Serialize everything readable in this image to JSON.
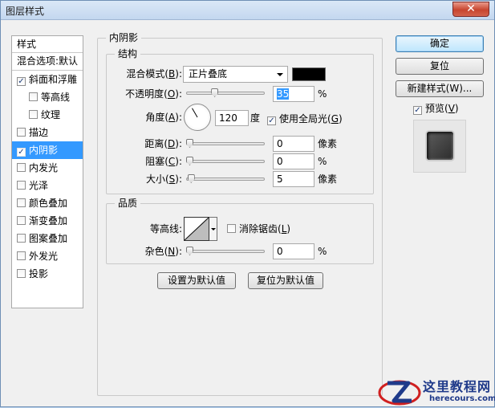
{
  "window": {
    "title": "图层样式"
  },
  "style_list": {
    "header": "样式",
    "blend_options": "混合选项:默认",
    "items": [
      {
        "label": "斜面和浮雕",
        "checked": true,
        "sub": false,
        "active": false
      },
      {
        "label": "等高线",
        "checked": false,
        "sub": true,
        "active": false
      },
      {
        "label": "纹理",
        "checked": false,
        "sub": true,
        "active": false
      },
      {
        "label": "描边",
        "checked": false,
        "sub": false,
        "active": false
      },
      {
        "label": "内阴影",
        "checked": true,
        "sub": false,
        "active": true
      },
      {
        "label": "内发光",
        "checked": false,
        "sub": false,
        "active": false
      },
      {
        "label": "光泽",
        "checked": false,
        "sub": false,
        "active": false
      },
      {
        "label": "颜色叠加",
        "checked": false,
        "sub": false,
        "active": false
      },
      {
        "label": "渐变叠加",
        "checked": false,
        "sub": false,
        "active": false
      },
      {
        "label": "图案叠加",
        "checked": false,
        "sub": false,
        "active": false
      },
      {
        "label": "外发光",
        "checked": false,
        "sub": false,
        "active": false
      },
      {
        "label": "投影",
        "checked": false,
        "sub": false,
        "active": false
      }
    ]
  },
  "panel": {
    "title": "内阴影",
    "structure": {
      "title": "结构",
      "blend_mode": {
        "label_pre": "混合模式(",
        "key": "B",
        "label_post": "):",
        "value": "正片叠底",
        "color": "#000000"
      },
      "opacity": {
        "label_pre": "不透明度(",
        "key": "O",
        "label_post": "):",
        "value": "35",
        "unit": "%",
        "level": 35
      },
      "angle": {
        "label_pre": "角度(",
        "key": "A",
        "label_post": "):",
        "value": "120",
        "unit": "度",
        "degrees": 120
      },
      "global_light": {
        "label_pre": "使用全局光(",
        "key": "G",
        "label_post": ")",
        "checked": true
      },
      "distance": {
        "label_pre": "距离(",
        "key": "D",
        "label_post": "):",
        "value": "0",
        "unit": "像素",
        "level": 0
      },
      "choke": {
        "label_pre": "阻塞(",
        "key": "C",
        "label_post": "):",
        "value": "0",
        "unit": "%",
        "level": 0
      },
      "size": {
        "label_pre": "大小(",
        "key": "S",
        "label_post": "):",
        "value": "5",
        "unit": "像素",
        "level": 2
      }
    },
    "quality": {
      "title": "品质",
      "contour_label": "等高线:",
      "anti_alias": {
        "label_pre": "消除锯齿(",
        "key": "L",
        "label_post": ")",
        "checked": false
      },
      "noise": {
        "label_pre": "杂色(",
        "key": "N",
        "label_post": "):",
        "value": "0",
        "unit": "%",
        "level": 0
      }
    },
    "make_default": "设置为默认值",
    "reset_default": "复位为默认值"
  },
  "buttons": {
    "ok": "确定",
    "reset": "复位",
    "new_style": "新建样式(W)...",
    "preview": {
      "label_pre": "预览(",
      "key": "V",
      "label_post": ")",
      "checked": true
    }
  },
  "watermark": {
    "cn": "这里教程网",
    "en": "herecours.com"
  }
}
